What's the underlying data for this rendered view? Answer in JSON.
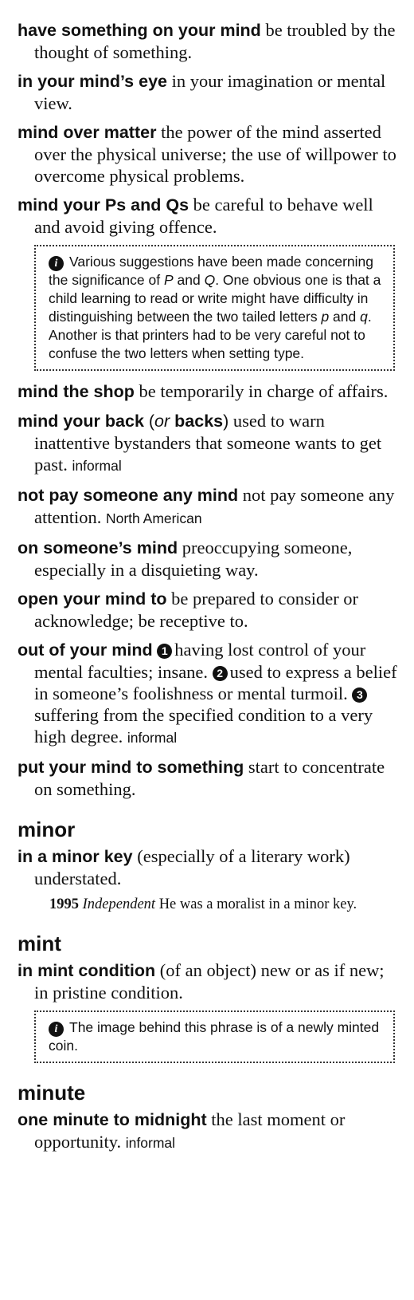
{
  "entries_mind": [
    {
      "phrase": "have something on your mind",
      "definition": "be troubled by the thought of something."
    },
    {
      "phrase": "in your mind’s eye",
      "definition": "in your imagination or mental view."
    },
    {
      "phrase": "mind over matter",
      "definition": "the power of the mind asserted over the physical universe; the use of willpower to overcome physical problems."
    },
    {
      "phrase": "mind your Ps and Qs",
      "definition": "be careful to behave well and avoid giving offence."
    },
    {
      "phrase": "mind the shop",
      "definition": "be temporarily in charge of affairs."
    },
    {
      "phrase_a": "mind your back",
      "phrase_paren_open": " (",
      "phrase_or": "or",
      "phrase_b": " backs",
      "phrase_paren_close": ")",
      "definition": "used to warn inattentive bystanders that someone wants to get past.",
      "label": "informal"
    },
    {
      "phrase": "not pay someone any mind",
      "definition": "not pay someone any attention.",
      "label": "North American"
    },
    {
      "phrase": "on someone’s mind",
      "definition": "preoccupying someone, especially in a disquieting way."
    },
    {
      "phrase": "open your mind to",
      "definition": "be prepared to consider or acknowledge; be receptive to."
    },
    {
      "phrase": "out of your mind",
      "senses": [
        "having lost control of your mental faculties; insane.",
        "used to express a belief in someone’s foolishness or mental turmoil.",
        "suffering from the specified condition to a very high degree."
      ],
      "sense_numbers": [
        "1",
        "2",
        "3"
      ],
      "label": "informal"
    },
    {
      "phrase": "put your mind to something",
      "definition": "start to concentrate on something."
    }
  ],
  "note_pq": {
    "icon": "i",
    "text_1": "Various suggestions have been made concerning the significance of ",
    "p": "P",
    "and_1": " and ",
    "q": "Q",
    "text_2": ". One obvious one is that a child learning to read or write might have difficulty in distinguishing between the two tailed letters ",
    "p_lower": "p",
    "and_2": " and ",
    "q_lower": "q",
    "text_3": ". Another is that printers had to be very careful not to confuse the two letters when setting type."
  },
  "minor": {
    "headword": "minor",
    "phrase": "in a minor key",
    "definition": "(especially of a literary work) understated.",
    "quote_year": "1995",
    "quote_source": "Independent",
    "quote_text": "He was a moralist in a minor key."
  },
  "mint": {
    "headword": "mint",
    "phrase": "in mint condition",
    "definition": "(of an object) new or as if new; in pristine condition.",
    "note_icon": "i",
    "note": "The image behind this phrase is of a newly minted coin."
  },
  "minute": {
    "headword": "minute",
    "phrase": "one minute to midnight",
    "definition": "the last moment or opportunity.",
    "label": "informal"
  }
}
